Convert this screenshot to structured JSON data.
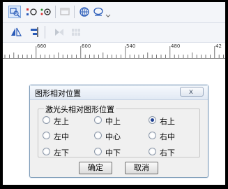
{
  "ruler": {
    "labels": [
      "660",
      "600",
      "540",
      "480",
      "42"
    ]
  },
  "dialog": {
    "title": "图形相对位置",
    "group_title": "激光头相对图形位置",
    "options": [
      {
        "label": "左上",
        "checked": false
      },
      {
        "label": "中上",
        "checked": false
      },
      {
        "label": "右上",
        "checked": true
      },
      {
        "label": "左中",
        "checked": false
      },
      {
        "label": "中心",
        "checked": false
      },
      {
        "label": "右中",
        "checked": false
      },
      {
        "label": "左下",
        "checked": false
      },
      {
        "label": "中下",
        "checked": false
      },
      {
        "label": "右下",
        "checked": false
      }
    ],
    "ok_label": "确定",
    "cancel_label": "取消",
    "close_symbol": "x"
  },
  "icons": {
    "toolbar1": [
      "zoom-select-icon",
      "node-edit-icon",
      "node-view-icon",
      "window-icon",
      "globe-icon",
      "monitor-icon",
      "dropdown-arrow-icon"
    ],
    "toolbar2": [
      "mirror-icon",
      "align-icon",
      "distribute-icon",
      "grid-icon"
    ]
  },
  "colors": {
    "accent": "#1d3f91",
    "dialog_border": "#7f9db9",
    "toolbar_bg": "#f3f5f9"
  }
}
